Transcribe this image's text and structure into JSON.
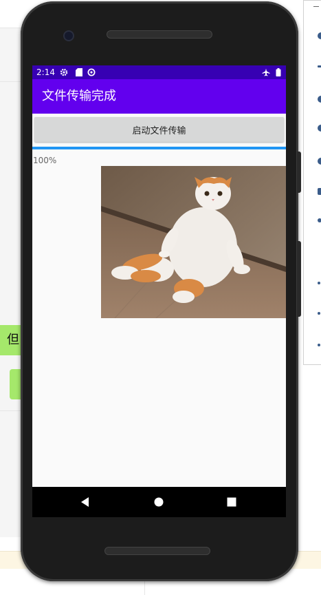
{
  "background": {
    "chat_text": "但"
  },
  "statusbar": {
    "time": "2:14",
    "left_icons": [
      "gear-icon",
      "sd-card-icon",
      "data-saver-icon"
    ],
    "right_icons": [
      "airplane-icon",
      "battery-icon"
    ],
    "background_color": "#3700b3"
  },
  "appbar": {
    "title": "文件传输完成",
    "background_color": "#6200ee"
  },
  "main": {
    "start_button_label": "启动文件传输",
    "progress_fraction": 1.0,
    "progress_text": "100%",
    "image_subject": "cat-photo"
  },
  "navbar": {
    "buttons": [
      "back-icon",
      "home-icon",
      "recents-icon"
    ]
  }
}
